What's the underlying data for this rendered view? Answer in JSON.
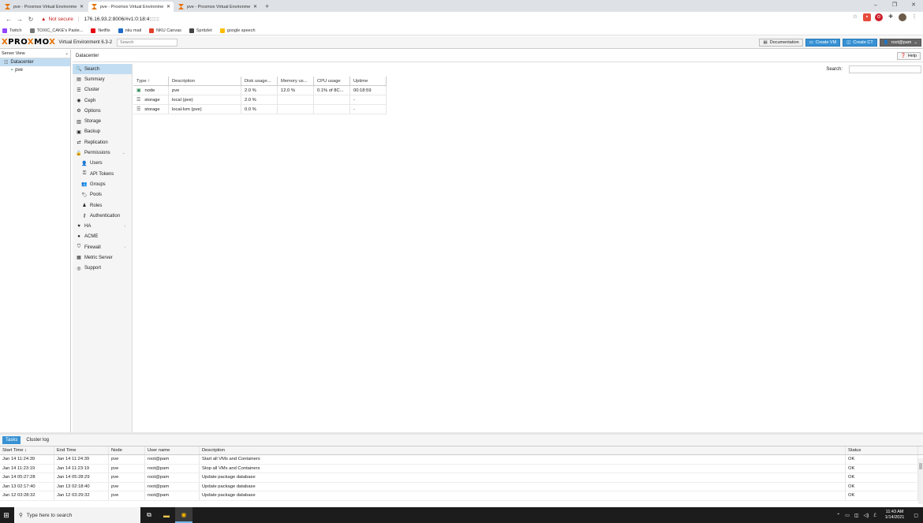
{
  "browser": {
    "tabs": [
      {
        "label": "pve - Proxmox Virtual Environme",
        "active": false
      },
      {
        "label": "pve - Proxmox Virtual Environme",
        "active": true
      },
      {
        "label": "pve - Proxmox Virtual Environme",
        "active": false
      }
    ],
    "new_tab": "+",
    "address": {
      "security": "Not secure",
      "url": "176.16.93.2:8006/#v1:0:18:4:::::::"
    },
    "bookmarks": [
      {
        "label": "Twitch",
        "color": "#9146ff"
      },
      {
        "label": "TOXIC_CAKE's Paste...",
        "color": "#777777"
      },
      {
        "label": "Netflix",
        "color": "#e50914"
      },
      {
        "label": "nku mail",
        "color": "#1e6ac8"
      },
      {
        "label": "NKU Canvas",
        "color": "#e13f2b"
      },
      {
        "label": "Spritzlet",
        "color": "#444444"
      },
      {
        "label": "google speech",
        "color": "#fbbc04"
      }
    ]
  },
  "pve_header": {
    "logo_a": "PRO",
    "logo_x": "X",
    "logo_b": "MO",
    "logo_c": "X",
    "version": "Virtual Environment 6.3-2",
    "search_placeholder": "Search",
    "buttons": {
      "documentation": "Documentation",
      "create_vm": "Create VM",
      "create_ct": "Create CT",
      "user": "root@pam"
    }
  },
  "tree": {
    "view": "Server View",
    "items": [
      {
        "label": "Datacenter",
        "selected": true
      },
      {
        "label": "pve",
        "selected": false
      }
    ]
  },
  "main": {
    "title": "Datacenter",
    "help": "Help",
    "menu": [
      {
        "label": "Search",
        "icon": "search-icon",
        "glyph": "🔍",
        "selected": true,
        "sub": false
      },
      {
        "label": "Summary",
        "icon": "book-icon",
        "glyph": "▤",
        "selected": false,
        "sub": false
      },
      {
        "label": "Cluster",
        "icon": "server-icon",
        "glyph": "☰",
        "selected": false,
        "sub": false
      },
      {
        "label": "Ceph",
        "icon": "ceph-icon",
        "glyph": "◉",
        "selected": false,
        "sub": false
      },
      {
        "label": "Options",
        "icon": "gear-icon",
        "glyph": "⚙",
        "selected": false,
        "sub": false
      },
      {
        "label": "Storage",
        "icon": "database-icon",
        "glyph": "▥",
        "selected": false,
        "sub": false
      },
      {
        "label": "Backup",
        "icon": "floppy-icon",
        "glyph": "▣",
        "selected": false,
        "sub": false
      },
      {
        "label": "Replication",
        "icon": "retweet-icon",
        "glyph": "⇄",
        "selected": false,
        "sub": false
      },
      {
        "label": "Permissions",
        "icon": "unlock-icon",
        "glyph": "🔓",
        "selected": false,
        "sub": false,
        "chevron": "⌄"
      },
      {
        "label": "Users",
        "icon": "user-icon",
        "glyph": "👤",
        "selected": false,
        "sub": true
      },
      {
        "label": "API Tokens",
        "icon": "key-icon",
        "glyph": "⚿",
        "selected": false,
        "sub": true
      },
      {
        "label": "Groups",
        "icon": "users-icon",
        "glyph": "👥",
        "selected": false,
        "sub": true
      },
      {
        "label": "Pools",
        "icon": "tags-icon",
        "glyph": "🏷",
        "selected": false,
        "sub": true
      },
      {
        "label": "Roles",
        "icon": "male-icon",
        "glyph": "♟",
        "selected": false,
        "sub": true
      },
      {
        "label": "Authentication",
        "icon": "key-icon",
        "glyph": "⚷",
        "selected": false,
        "sub": true
      },
      {
        "label": "HA",
        "icon": "heartbeat-icon",
        "glyph": "♥",
        "selected": false,
        "sub": false,
        "chevron": "›"
      },
      {
        "label": "ACME",
        "icon": "certificate-icon",
        "glyph": "●",
        "selected": false,
        "sub": false
      },
      {
        "label": "Firewall",
        "icon": "shield-icon",
        "glyph": "⛉",
        "selected": false,
        "sub": false,
        "chevron": "›"
      },
      {
        "label": "Metric Server",
        "icon": "bar-chart-icon",
        "glyph": "▦",
        "selected": false,
        "sub": false
      },
      {
        "label": "Support",
        "icon": "support-icon",
        "glyph": "◎",
        "selected": false,
        "sub": false
      }
    ],
    "search_label": "Search:",
    "grid": {
      "columns": [
        "Type ↑",
        "Description",
        "Disk usage...",
        "Memory us...",
        "CPU usage",
        "Uptime"
      ],
      "rows": [
        {
          "type": "node",
          "icon": "node-icon",
          "description": "pve",
          "disk": "2.0 %",
          "memory": "12.0 %",
          "cpu": "0.1% of 8C...",
          "uptime": "00:18:59"
        },
        {
          "type": "storage",
          "icon": "database-icon",
          "description": "local (pve)",
          "disk": "2.0 %",
          "memory": "",
          "cpu": "",
          "uptime": "-"
        },
        {
          "type": "storage",
          "icon": "database-icon",
          "description": "local-lvm (pve)",
          "disk": "0.0 %",
          "memory": "",
          "cpu": "",
          "uptime": "-"
        }
      ]
    }
  },
  "tasks": {
    "tabs": [
      {
        "label": "Tasks",
        "active": true
      },
      {
        "label": "Cluster log",
        "active": false
      }
    ],
    "columns": [
      "Start Time ↓",
      "End Time",
      "Node",
      "User name",
      "Description",
      "Status"
    ],
    "rows": [
      {
        "start": "Jan 14 11:24:39",
        "end": "Jan 14 11:24:39",
        "node": "pve",
        "user": "root@pam",
        "description": "Start all VMs and Containers",
        "status": "OK"
      },
      {
        "start": "Jan 14 11:23:19",
        "end": "Jan 14 11:23:19",
        "node": "pve",
        "user": "root@pam",
        "description": "Stop all VMs and Containers",
        "status": "OK"
      },
      {
        "start": "Jan 14 05:27:28",
        "end": "Jan 14 05:28:29",
        "node": "pve",
        "user": "root@pam",
        "description": "Update package database",
        "status": "OK"
      },
      {
        "start": "Jan 13 02:17:40",
        "end": "Jan 13 02:18:40",
        "node": "pve",
        "user": "root@pam",
        "description": "Update package database",
        "status": "OK"
      },
      {
        "start": "Jan 12 03:28:32",
        "end": "Jan 12 03:29:32",
        "node": "pve",
        "user": "root@pam",
        "description": "Update package database",
        "status": "OK"
      }
    ]
  },
  "taskbar": {
    "search_placeholder": "Type here to search",
    "time": "11:43 AM",
    "date": "1/14/2021"
  },
  "colors": {
    "accent": "#3892d4",
    "selection": "#c2ddf2",
    "proxmox_orange": "#e57000"
  }
}
